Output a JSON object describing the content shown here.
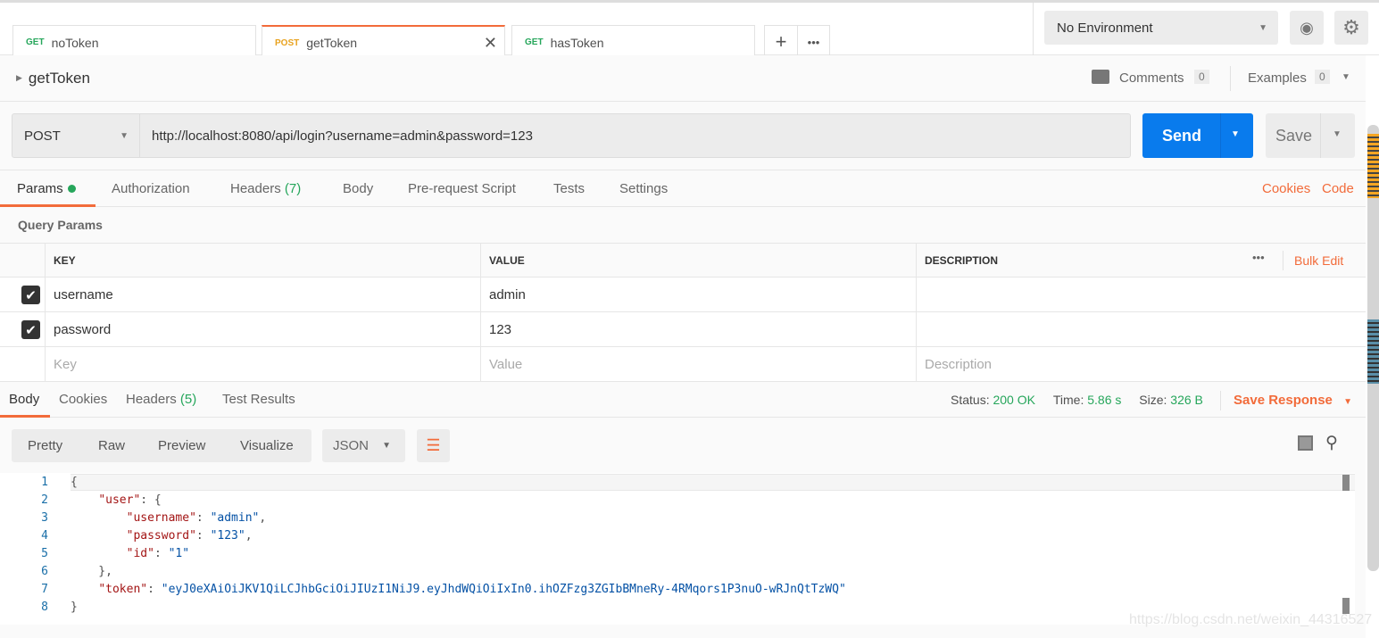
{
  "tabs": [
    {
      "method": "GET",
      "name": "noToken"
    },
    {
      "method": "POST",
      "name": "getToken",
      "active": true
    },
    {
      "method": "GET",
      "name": "hasToken"
    }
  ],
  "tab_actions": {
    "add": "+",
    "more": "•••"
  },
  "environment": {
    "selected": "No Environment"
  },
  "request": {
    "title": "getToken",
    "comments_label": "Comments",
    "comments_count": "0",
    "examples_label": "Examples",
    "examples_count": "0",
    "method": "POST",
    "url": "http://localhost:8080/api/login?username=admin&password=123",
    "send": "Send",
    "save": "Save"
  },
  "req_tabs": [
    {
      "label": "Params",
      "active": true
    },
    {
      "label": "Authorization"
    },
    {
      "label": "Headers",
      "count": "(7)"
    },
    {
      "label": "Body"
    },
    {
      "label": "Pre-request Script"
    },
    {
      "label": "Tests"
    },
    {
      "label": "Settings"
    }
  ],
  "req_links": {
    "cookies": "Cookies",
    "code": "Code"
  },
  "params": {
    "title": "Query Params",
    "headers": [
      "KEY",
      "VALUE",
      "DESCRIPTION"
    ],
    "bulk_edit": "Bulk Edit",
    "rows": [
      {
        "checked": true,
        "key": "username",
        "value": "admin",
        "description": ""
      },
      {
        "checked": true,
        "key": "password",
        "value": "123",
        "description": ""
      }
    ],
    "placeholders": {
      "key": "Key",
      "value": "Value",
      "description": "Description"
    }
  },
  "resp_tabs": [
    {
      "label": "Body",
      "active": true
    },
    {
      "label": "Cookies"
    },
    {
      "label": "Headers",
      "count": "(5)"
    },
    {
      "label": "Test Results"
    }
  ],
  "status": {
    "status_label": "Status:",
    "status": "200 OK",
    "time_label": "Time:",
    "time": "5.86 s",
    "size_label": "Size:",
    "size": "326 B",
    "save_response": "Save Response"
  },
  "view_modes": [
    "Pretty",
    "Raw",
    "Preview",
    "Visualize"
  ],
  "format": "JSON",
  "code_lines": [
    [
      [
        "p",
        "{"
      ]
    ],
    [
      [
        "p",
        "    "
      ],
      [
        "k",
        "\"user\""
      ],
      [
        "p",
        ": {"
      ]
    ],
    [
      [
        "p",
        "        "
      ],
      [
        "k",
        "\"username\""
      ],
      [
        "p",
        ": "
      ],
      [
        "s",
        "\"admin\""
      ],
      [
        "p",
        ","
      ]
    ],
    [
      [
        "p",
        "        "
      ],
      [
        "k",
        "\"password\""
      ],
      [
        "p",
        ": "
      ],
      [
        "s",
        "\"123\""
      ],
      [
        "p",
        ","
      ]
    ],
    [
      [
        "p",
        "        "
      ],
      [
        "k",
        "\"id\""
      ],
      [
        "p",
        ": "
      ],
      [
        "s",
        "\"1\""
      ]
    ],
    [
      [
        "p",
        "    },"
      ]
    ],
    [
      [
        "p",
        "    "
      ],
      [
        "k",
        "\"token\""
      ],
      [
        "p",
        ": "
      ],
      [
        "s",
        "\"eyJ0eXAiOiJKV1QiLCJhbGciOiJIUzI1NiJ9.eyJhdWQiOiIxIn0.ihOZFzg3ZGIbBMneRy-4RMqors1P3nuO-wRJnQtTzWQ\""
      ]
    ],
    [
      [
        "p",
        "}"
      ]
    ]
  ],
  "watermark": "https://blog.csdn.net/weixin_44316527",
  "colors": {
    "accent": "#f26b3a",
    "send": "#097bed",
    "success": "#26a65b"
  }
}
